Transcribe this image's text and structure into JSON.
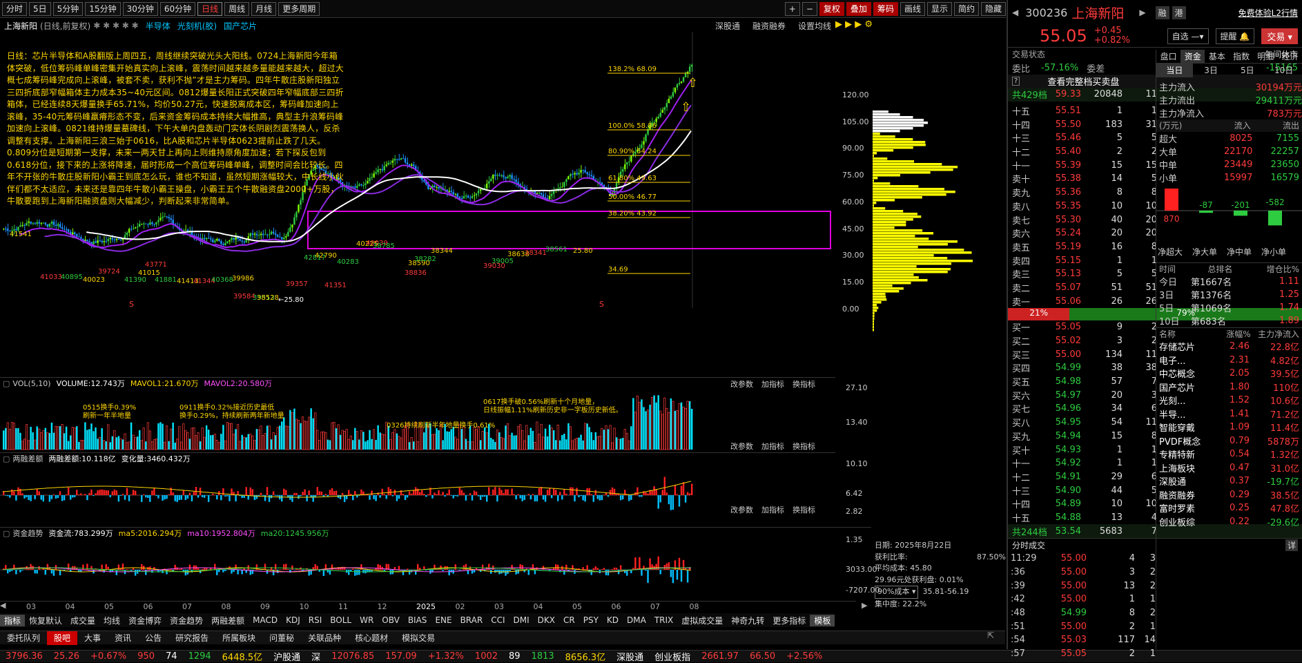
{
  "topbar": {
    "periods": [
      "分时",
      "5日",
      "5分钟",
      "15分钟",
      "30分钟",
      "60分钟",
      "日线",
      "周线",
      "月线",
      "更多周期"
    ],
    "right": [
      "+",
      "−",
      "复权",
      "叠加",
      "筹码",
      "画线",
      "显示",
      "简约",
      "隐藏"
    ]
  },
  "sub": {
    "title": "上海新阳",
    "mode": "(日线,前复权)",
    "sectors": [
      "半导体",
      "光刻机(胶)",
      "国产芯片"
    ],
    "tools": [
      "深股通",
      "融资融券",
      "设置均线"
    ]
  },
  "annotation": "日线：芯片半导体和A股翻版上周四五，周线继续突破光头大阳线。0724上海新阳今年箱体突破，低位筹码峰单峰密集开始真实向上滚峰，震荡时间越来越多量能越来越大，超过大概七成筹码峰完成向上滚峰，被套不卖，获利不抛”才是主力筹码。四年牛散庄股新阳独立三四折底部窄幅箱体主力成本35~40元区间。0812爆量长阳正式突破四年窄幅底部三四折箱体，已经连续8天爆量换手65.71%，均价50.27元，快速脱离成本区，筹码峰加速向上滚峰，35-40元筹码峰羸瘠形态不变，后来资金筹码成本持续大幅推高，典型主升浪筹码峰加速向上滚峰。0821维持爆量墓碑线，下午大单内盘轰动门实体长阴剧烈震荡换人，反杀调整有支撑。上海新阳三浪三始于0616，比A股和芯片半导体0623提前止跌了几天。0.809分位是短期第一支撑，未来一两天甘上再向上则维持原角度加速；若下探反包到0.618分位，接下来的上涨将降速，届时形成一个高位筹码峰单峰，调整时间会比较长。四年不开张的牛散庄股新阳小霸王到底怎么玩，谁也不知道，虽然短期涨幅较大，中长线小伙伴们都不太适应，未来还是靠四年牛散小霸王操盘，小霸王五个牛散融资盘2000+万股，牛散要跑到上海新阳融资盘则大幅减少，判断起来非常简单。",
  "price_axis": [
    "120.00",
    "105.00",
    "90.00",
    "75.00",
    "60.00",
    "45.00",
    "30.00",
    "15.00",
    "0.00"
  ],
  "fib": [
    "138.2% 68.09",
    "100.0% 58.86",
    "80.90% 54.24",
    "61.80% 49.63",
    "50.00% 46.77",
    "38.20% 43.92",
    "34.69"
  ],
  "lows": [
    "41541",
    "41033",
    "40895",
    "40023",
    "39724",
    "41390",
    "41015",
    "43771",
    "41881",
    "41413",
    "41344",
    "40368",
    "39986",
    "39584",
    "39513",
    "38528",
    "39357",
    "42817",
    "42790",
    "41351",
    "40283",
    "40225",
    "40039",
    "38785",
    "38590",
    "38836",
    "38282",
    "38344",
    "39030",
    "39005",
    "38638",
    "38341",
    "38561",
    "25.80"
  ],
  "vol": {
    "label": "VOL(5,10)",
    "volume": "VOLUME:12.743万",
    "m1": "MAVOL1:21.670万",
    "m2": "MAVOL2:20.580万",
    "ax": [
      "27.10",
      "13.40"
    ],
    "notes": [
      "0515换手0.39%",
      "刷新一年半地量",
      "0911换手0.32%接近历史最低",
      "换手0.29%，持续刷新两年新地量",
      "0326持续刷新半年地量换手0.61%",
      "0617换手破0.56%刷新十个月地量，",
      "日线振幅1.11%刷新历史非一字板历史新低。"
    ]
  },
  "margin": {
    "title": "两融差额",
    "v": "两融差额:10.118亿",
    "chg": "变化量:3460.432万",
    "ax": [
      "10.10",
      "6.42",
      "2.82"
    ]
  },
  "fund": {
    "title": "资金趋势",
    "v": "资金流:783.299万",
    "m5": "ma5:2016.294万",
    "m10": "ma10:1952.804万",
    "m20": "ma20:1245.956万",
    "ax": [
      "1.35",
      "3033.00",
      "-7207.00"
    ]
  },
  "panel_tools": [
    "改参数",
    "加指标",
    "换指标"
  ],
  "months": [
    "03",
    "04",
    "05",
    "06",
    "07",
    "08",
    "09",
    "10",
    "11",
    "12",
    "2025",
    "02",
    "03",
    "04",
    "05",
    "06",
    "07",
    "08"
  ],
  "chip": {
    "date": "日期: 2025年8月22日",
    "profit_label": "获利比率:",
    "profit": "87.50%",
    "avg": "平均成本: 45.80",
    "zero": "29.96元处获利盘: 0.01%",
    "cost90": "90%成本",
    "range": "35.81-56.19",
    "conc": "集中度: 22.2%"
  },
  "indtabs": [
    "指标",
    "恢复默认",
    "成交量",
    "均线",
    "资金博弈",
    "资金趋势",
    "两融差额",
    "MACD",
    "KDJ",
    "RSI",
    "BOLL",
    "WR",
    "OBV",
    "BIAS",
    "ENE",
    "BRAR",
    "CCI",
    "DMI",
    "DKX",
    "CR",
    "PSY",
    "KD",
    "DMA",
    "TRIX",
    "虚拟成交量",
    "神奇九转",
    "更多指标",
    "模板"
  ],
  "bottomtabs": [
    "委托队列",
    "股吧",
    "大事",
    "资讯",
    "公告",
    "研究报告",
    "所属板块",
    "问董秘",
    "关联品种",
    "核心题材",
    "模拟交易"
  ],
  "ticker": [
    "3796.36",
    "25.26",
    "+0.67%",
    "950",
    "74",
    "1294",
    "6448.5亿",
    "沪股通",
    "深",
    "12076.85",
    "157.09",
    "+1.32%",
    "1002",
    "89",
    "1813",
    "8656.3亿",
    "深股通",
    "创业板指",
    "2661.97",
    "66.50",
    "+2.56%"
  ],
  "stock": {
    "code": "300236",
    "name": "上海新阳",
    "price": "55.05",
    "chg": "+0.45",
    "pct": "+0.82%",
    "btns": [
      "融",
      "港"
    ],
    "l2": "免费体验L2行情",
    "zixuan": "自选",
    "remind": "提醒",
    "trade": "交易"
  },
  "state": {
    "label": "交易状态",
    "value": "午间休市",
    "wb_l": "委比",
    "wb": "-57.16%",
    "wc_l": "委差",
    "wc": "-15165",
    "link": "查看完整档买卖盘"
  },
  "asks_total": {
    "label": "共429档",
    "p": "59.33",
    "v": "20848",
    "n": "11"
  },
  "asks": [
    [
      "十五",
      "55.51",
      "1",
      "1"
    ],
    [
      "十四",
      "55.50",
      "183",
      "31"
    ],
    [
      "十三",
      "55.46",
      "5",
      "5"
    ],
    [
      "十二",
      "55.40",
      "2",
      "2"
    ],
    [
      "十一",
      "55.39",
      "15",
      "15"
    ],
    [
      "卖十",
      "55.38",
      "14",
      "5"
    ],
    [
      "卖九",
      "55.36",
      "8",
      "8"
    ],
    [
      "卖八",
      "55.35",
      "10",
      "10"
    ],
    [
      "卖七",
      "55.30",
      "40",
      "20"
    ],
    [
      "卖六",
      "55.24",
      "20",
      "20"
    ],
    [
      "卖五",
      "55.19",
      "16",
      "8"
    ],
    [
      "卖四",
      "55.15",
      "1",
      "1"
    ],
    [
      "卖三",
      "55.13",
      "5",
      "5"
    ],
    [
      "卖二",
      "55.07",
      "51",
      "51"
    ],
    [
      "卖一",
      "55.06",
      "26",
      "26"
    ]
  ],
  "ratio": [
    "21%",
    "79%"
  ],
  "bids": [
    [
      "买一",
      "55.05",
      "9",
      "2"
    ],
    [
      "买二",
      "55.02",
      "3",
      "2"
    ],
    [
      "买三",
      "55.00",
      "134",
      "11"
    ],
    [
      "买四",
      "54.99",
      "38",
      "38"
    ],
    [
      "买五",
      "54.98",
      "57",
      "7"
    ],
    [
      "买六",
      "54.97",
      "20",
      "3"
    ],
    [
      "买七",
      "54.96",
      "34",
      "6"
    ],
    [
      "买八",
      "54.95",
      "54",
      "11"
    ],
    [
      "买九",
      "54.94",
      "15",
      "8"
    ],
    [
      "买十",
      "54.93",
      "1",
      "1"
    ],
    [
      "十一",
      "54.92",
      "1",
      "1"
    ],
    [
      "十二",
      "54.91",
      "29",
      "6"
    ],
    [
      "十三",
      "54.90",
      "44",
      "5"
    ],
    [
      "十四",
      "54.89",
      "10",
      "10"
    ],
    [
      "十五",
      "54.88",
      "13",
      "4"
    ]
  ],
  "bids_total": {
    "label": "共244档",
    "p": "53.54",
    "v": "5683",
    "n": "7"
  },
  "trades_title": "分时成交",
  "trades_more": "详",
  "trades": [
    [
      "11:29",
      "55.00",
      "4",
      "3"
    ],
    [
      ":36",
      "55.00",
      "3",
      "2"
    ],
    [
      ":39",
      "55.00",
      "13",
      "2"
    ],
    [
      ":42",
      "55.00",
      "1",
      "1"
    ],
    [
      ":48",
      "54.99",
      "8",
      "2"
    ],
    [
      ":51",
      "55.00",
      "2",
      "1"
    ],
    [
      ":54",
      "55.03",
      "117",
      "14"
    ],
    [
      ":57",
      "55.05",
      "2",
      "1"
    ]
  ],
  "tabs": [
    "盘口",
    "资金",
    "基本",
    "指数",
    "明细",
    "经济"
  ],
  "tabs2": [
    "当日",
    "3日",
    "5日",
    "10日"
  ],
  "flow": [
    [
      "主力流入",
      "30194万元"
    ],
    [
      "主力流出",
      "29411万元"
    ],
    [
      "主力净流入",
      "783万元"
    ]
  ],
  "flowhead": [
    "(万元)",
    "流入",
    "流出"
  ],
  "flowtable": [
    [
      "超大",
      "8025",
      "7155"
    ],
    [
      "大单",
      "22170",
      "22257"
    ],
    [
      "中单",
      "23449",
      "23650"
    ],
    [
      "小单",
      "15997",
      "16579"
    ]
  ],
  "netbars": [
    870,
    -87,
    -201,
    -582
  ],
  "netlabels": [
    "净超大",
    "净大单",
    "净中单",
    "净小单"
  ],
  "rank_head": [
    "时间",
    "总排名",
    "增仓比%"
  ],
  "rank": [
    [
      "今日",
      "第1667名",
      "1.11"
    ],
    [
      "3日",
      "第1376名",
      "1.25"
    ],
    [
      "5日",
      "第1069名",
      "1.74"
    ],
    [
      "10日",
      "第683名",
      "1.89"
    ]
  ],
  "sec_head": [
    "名称",
    "涨幅%",
    "主力净流入"
  ],
  "sectors": [
    [
      "存储芯片",
      "2.46",
      "22.8亿"
    ],
    [
      "电子...",
      "2.31",
      "4.82亿"
    ],
    [
      "中芯概念",
      "2.05",
      "39.5亿"
    ],
    [
      "国产芯片",
      "1.80",
      "110亿"
    ],
    [
      "光刻...",
      "1.52",
      "10.6亿"
    ],
    [
      "半导...",
      "1.41",
      "71.2亿"
    ],
    [
      "智能穿戴",
      "1.09",
      "11.4亿"
    ],
    [
      "PVDF概念",
      "0.79",
      "5878万"
    ],
    [
      "专精特新",
      "0.54",
      "1.32亿"
    ],
    [
      "上海板块",
      "0.47",
      "31.0亿"
    ],
    [
      "深股通",
      "0.37",
      "-19.7亿"
    ],
    [
      "融资融券",
      "0.29",
      "38.5亿"
    ],
    [
      "富时罗素",
      "0.25",
      "47.8亿"
    ],
    [
      "创业板综",
      "0.22",
      "-29.6亿"
    ]
  ]
}
